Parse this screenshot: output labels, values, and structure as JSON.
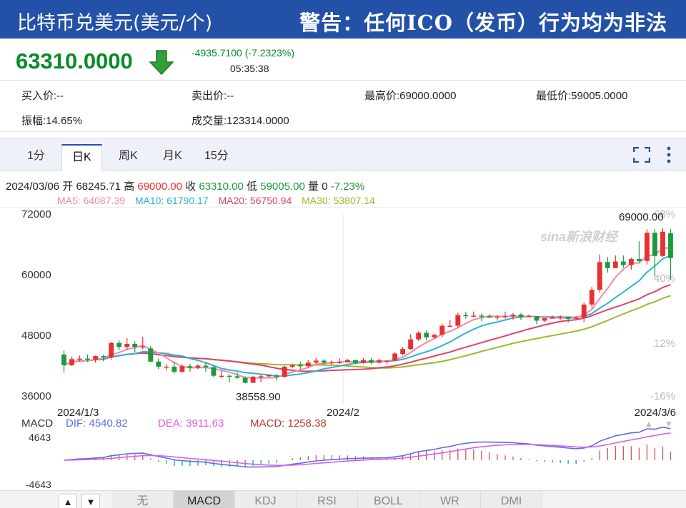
{
  "header": {
    "title": "比特币兑美元(美元/个)",
    "warning": "警告：任何ICO（发币）行为均为非法"
  },
  "quote": {
    "price": "63310.0000",
    "change": "-4935.7100 (-7.2323%)",
    "time": "05:35:38",
    "direction": "down"
  },
  "stats": {
    "bid": "买入价:--",
    "ask": "卖出价:--",
    "high": "最高价:69000.0000",
    "low": "最低价:59005.0000",
    "amplitude": "振幅:14.65%",
    "volume": "成交量:123314.0000"
  },
  "tabs": [
    "1分",
    "日K",
    "周K",
    "月K",
    "15分"
  ],
  "active_tab": "日K",
  "ohlc": {
    "date": "2024/03/06",
    "open_label": "开",
    "open": "68245.71",
    "high_label": "高",
    "high": "69000.00",
    "close_label": "收",
    "close": "63310.00",
    "low_label": "低",
    "low": "59005.00",
    "vol_label": "量",
    "vol": "0",
    "change": "-7.23%"
  },
  "ma_legend": [
    {
      "label": "MA5: 64087.39",
      "color": "#f08aa8"
    },
    {
      "label": "MA10: 61790.17",
      "color": "#2db3d2"
    },
    {
      "label": "MA20: 56750.94",
      "color": "#e0426a"
    },
    {
      "label": "MA30: 53807.14",
      "color": "#9cba2c"
    }
  ],
  "macd_legend": {
    "name": "MACD",
    "dif": "DIF: 4540.82",
    "dea": "DEA: 3911.63",
    "macd": "MACD: 1258.38"
  },
  "watermark": "sina新浪财经",
  "colors": {
    "up": "#e8312f",
    "down": "#1a9a3c",
    "brand": "#2451a8",
    "dif": "#5b6fe0",
    "dea": "#e05ce8"
  },
  "indicator_tabs": [
    "无",
    "MACD",
    "KDJ",
    "RSI",
    "BOLL",
    "WR",
    "DMI"
  ],
  "active_indicator": "MACD",
  "chart_data": {
    "type": "candlestick",
    "y_ticks": [
      "72000",
      "60000",
      "48000",
      "36000"
    ],
    "y_range": [
      36000,
      72000
    ],
    "pct_ticks": [
      "68%",
      "40%",
      "12%",
      "-16%"
    ],
    "x_labels": [
      "2024/1/3",
      "2024/2",
      "2024/3/6"
    ],
    "max_label": "69000.00",
    "min_label": "38558.90",
    "macd_ticks": [
      "4643",
      "-4643"
    ],
    "macd_range": [
      -4643,
      4643
    ],
    "candles": [
      [
        44200,
        42100,
        45000,
        40600
      ],
      [
        42100,
        43300,
        43800,
        41900
      ],
      [
        43300,
        43400,
        44000,
        42800
      ],
      [
        43400,
        43200,
        44200,
        42700
      ],
      [
        43200,
        43900,
        44000,
        42600
      ],
      [
        43900,
        43700,
        44200,
        42900
      ],
      [
        43600,
        46500,
        46700,
        43200
      ],
      [
        46500,
        45700,
        47000,
        45100
      ],
      [
        45700,
        46300,
        47500,
        45100
      ],
      [
        46300,
        45700,
        46800,
        44700
      ],
      [
        45700,
        45800,
        47700,
        45200
      ],
      [
        45400,
        42800,
        45900,
        42700
      ],
      [
        42800,
        41800,
        43400,
        41300
      ],
      [
        41800,
        41800,
        42300,
        41100
      ],
      [
        41800,
        40800,
        42800,
        40400
      ],
      [
        40800,
        41900,
        42300,
        40600
      ],
      [
        41900,
        41600,
        42400,
        40800
      ],
      [
        41600,
        42000,
        42300,
        41300
      ],
      [
        42000,
        41700,
        42700,
        40800
      ],
      [
        41700,
        40000,
        42100,
        39700
      ],
      [
        40000,
        40000,
        41000,
        39600
      ],
      [
        40000,
        39900,
        40300,
        38700
      ],
      [
        39900,
        39600,
        40600,
        39400
      ],
      [
        39600,
        38600,
        39900,
        38500
      ],
      [
        38600,
        39800,
        40000,
        38600
      ],
      [
        39800,
        39900,
        40200,
        38700
      ],
      [
        39900,
        40100,
        40300,
        39700
      ],
      [
        40100,
        39800,
        40400,
        39100
      ],
      [
        39800,
        41800,
        42000,
        39600
      ],
      [
        41800,
        42100,
        42300,
        41500
      ],
      [
        42100,
        41900,
        42800,
        41200
      ],
      [
        41900,
        42600,
        43100,
        41700
      ],
      [
        42600,
        43000,
        43600,
        42300
      ],
      [
        43000,
        42600,
        43300,
        42200
      ],
      [
        42600,
        42700,
        43100,
        42100
      ],
      [
        42700,
        42700,
        43400,
        42400
      ],
      [
        42700,
        43100,
        43300,
        42600
      ],
      [
        43100,
        42600,
        43200,
        42300
      ],
      [
        42600,
        43100,
        43500,
        42400
      ],
      [
        43100,
        42600,
        43500,
        42300
      ],
      [
        42600,
        43100,
        43400,
        42400
      ],
      [
        43000,
        43000,
        43100,
        42300
      ],
      [
        43000,
        44400,
        44700,
        43000
      ],
      [
        44300,
        45300,
        45700,
        44000
      ],
      [
        45300,
        47200,
        48200,
        45100
      ],
      [
        47200,
        48500,
        48800,
        46900
      ],
      [
        48500,
        47600,
        49000,
        47000
      ],
      [
        47600,
        48100,
        48300,
        47300
      ],
      [
        48100,
        49900,
        50300,
        47600
      ],
      [
        49900,
        49900,
        51000,
        49700
      ],
      [
        49900,
        52000,
        52500,
        49500
      ],
      [
        52000,
        51800,
        52600,
        51300
      ],
      [
        51800,
        51900,
        52700,
        51600
      ],
      [
        51900,
        51800,
        52300,
        50800
      ],
      [
        51800,
        51500,
        52200,
        51500
      ],
      [
        51500,
        51700,
        52000,
        50900
      ],
      [
        51700,
        51800,
        52700,
        51300
      ],
      [
        51800,
        52100,
        52400,
        51100
      ],
      [
        52100,
        51600,
        52400,
        51000
      ],
      [
        51600,
        51800,
        52100,
        51600
      ],
      [
        51800,
        50900,
        51300,
        50200
      ],
      [
        50900,
        51400,
        51400,
        50600
      ],
      [
        51300,
        51600,
        51900,
        51300
      ],
      [
        51600,
        51700,
        52000,
        51100
      ],
      [
        51700,
        51300,
        51700,
        50500
      ],
      [
        51300,
        51500,
        51800,
        51100
      ],
      [
        51500,
        54100,
        54500,
        50600
      ],
      [
        54100,
        57000,
        57600,
        53500
      ],
      [
        57000,
        62500,
        64000,
        56500
      ],
      [
        62500,
        61300,
        63500,
        60400
      ],
      [
        61300,
        62600,
        63800,
        61300
      ],
      [
        62600,
        61900,
        63800,
        61400
      ],
      [
        61900,
        63100,
        63400,
        61000
      ],
      [
        63100,
        62700,
        66600,
        62400
      ],
      [
        62700,
        68300,
        69000,
        62000
      ],
      [
        68300,
        63700,
        69000,
        59600
      ],
      [
        63700,
        68500,
        69200,
        63500
      ],
      [
        68200,
        63300,
        69000,
        59000
      ]
    ],
    "ma5_end": 64087.39,
    "ma10_end": 61790.17,
    "ma20_end": 56750.94,
    "ma30_end": 53807.14,
    "dif_end": 4540.82,
    "dea_end": 3911.63,
    "macd_end": 1258.38
  }
}
